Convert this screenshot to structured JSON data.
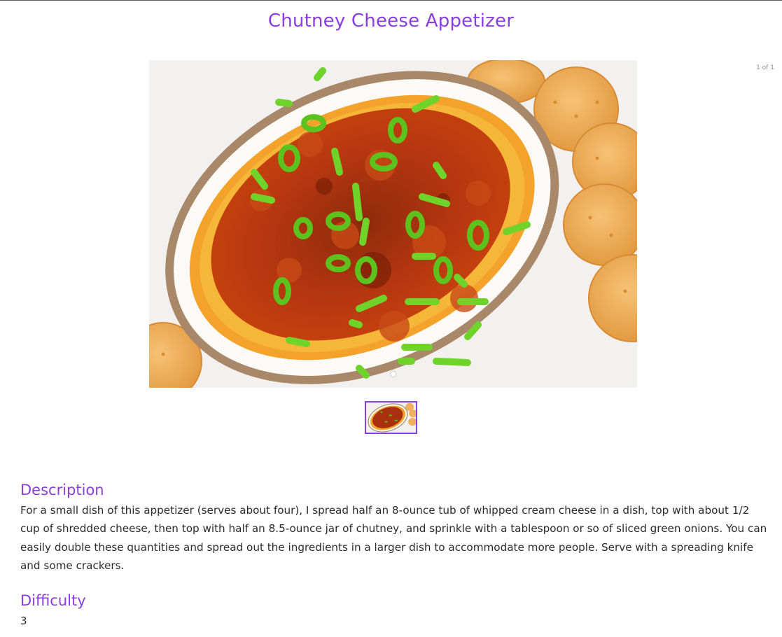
{
  "recipe": {
    "title": "Chutney Cheese Appetizer",
    "image_counter": "1 of 1",
    "image_alt": "Chutney Cheese Appetizer",
    "description_heading": "Description",
    "description": "For a small dish of this appetizer (serves about four), I spread half an 8-ounce tub of whipped cream cheese in a dish, top with about 1/2 cup of shredded cheese, then top with half an 8.5-ounce jar of chutney, and sprinkle with a tablespoon or so of sliced green onions. You can easily double these quantities and spread out the ingredients in a larger dish to accommodate more people. Serve with a spreading knife and some crackers.",
    "difficulty_heading": "Difficulty",
    "difficulty": "3"
  },
  "carousel": {
    "slide_count": 1,
    "active_index": 0
  },
  "colors": {
    "accent": "#8a3ee0",
    "text": "#2b2b2b",
    "counter": "#8a8a8a"
  }
}
